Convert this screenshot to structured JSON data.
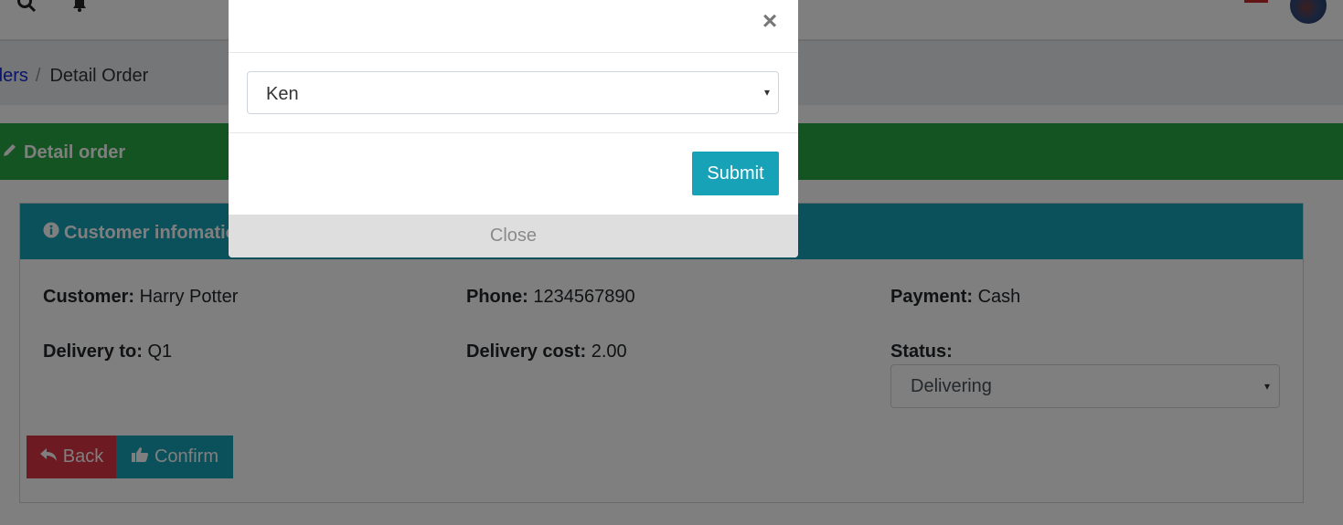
{
  "breadcrumb": {
    "link": "ders",
    "separator": "/",
    "current": "Detail Order"
  },
  "section": {
    "title": "Detail order"
  },
  "card": {
    "title": "Customer infomation",
    "customer_label": "Customer:",
    "customer_value": "Harry Potter",
    "phone_label": "Phone:",
    "phone_value": "1234567890",
    "payment_label": "Payment:",
    "payment_value": "Cash",
    "delivery_label": "Delivery to:",
    "delivery_value": "Q1",
    "cost_label": "Delivery cost:",
    "cost_value": "2.00",
    "status_label": "Status:",
    "status_value": "Delivering"
  },
  "buttons": {
    "back": "Back",
    "confirm": "Confirm"
  },
  "modal": {
    "close_x": "×",
    "selected": "Ken",
    "submit": "Submit",
    "close": "Close"
  },
  "colors": {
    "success": "#28a745",
    "info": "#17a2b8",
    "danger": "#dc3545"
  },
  "icons": [
    "search-icon",
    "bell-icon",
    "pencil-icon",
    "info-icon",
    "reply-icon",
    "thumbs-up-icon"
  ]
}
